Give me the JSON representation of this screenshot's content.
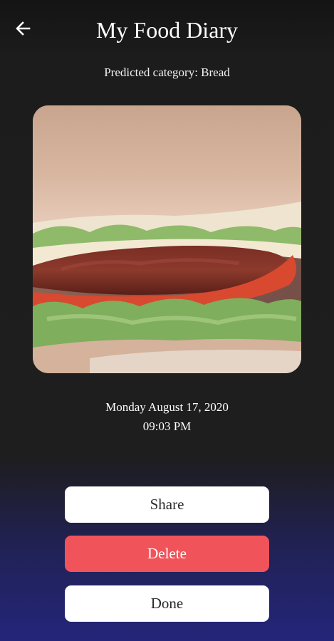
{
  "header": {
    "title": "My Food Diary",
    "back_icon": "arrow-left-icon"
  },
  "prediction": {
    "text": "Predicted category: Bread"
  },
  "entry": {
    "date": "Monday August 17, 2020",
    "time": "09:03 PM"
  },
  "actions": {
    "share_label": "Share",
    "delete_label": "Delete",
    "done_label": "Done"
  },
  "colors": {
    "background": "#1c1c1c",
    "gradient_bottom": "#24257a",
    "delete_button": "#f0545a",
    "button_light": "#ffffff"
  }
}
